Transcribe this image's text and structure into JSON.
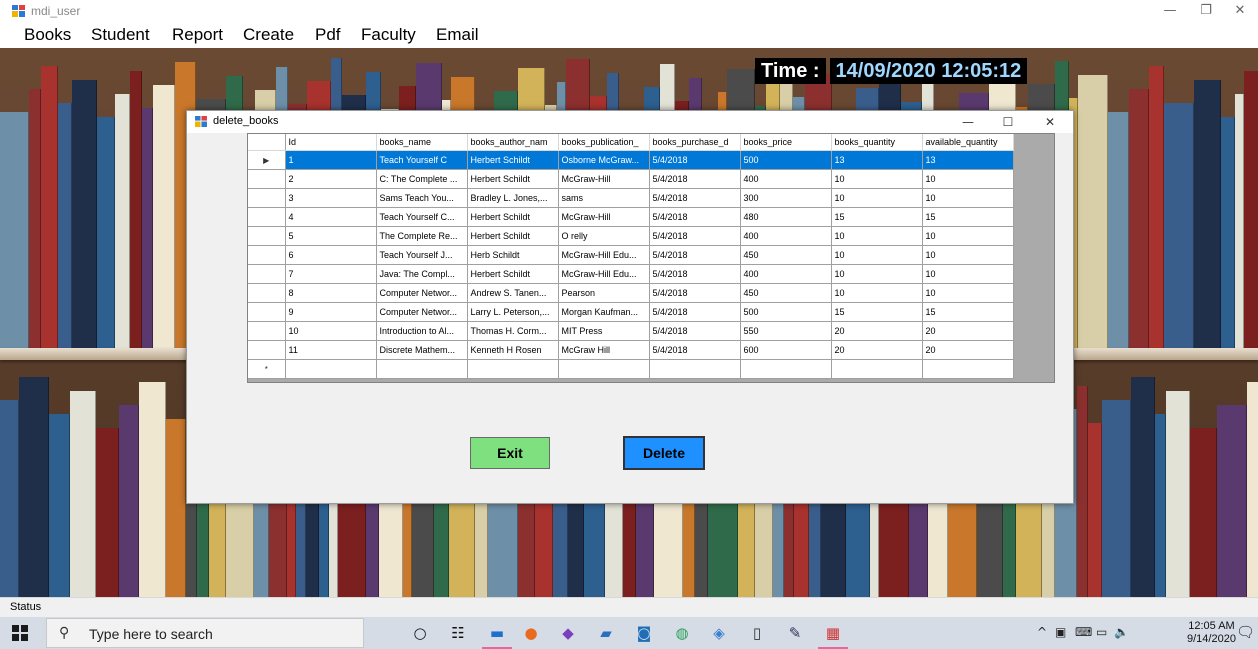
{
  "window": {
    "title": "mdi_user",
    "minimize_glyph": "—",
    "restore_glyph": "❐",
    "close_glyph": "✕"
  },
  "menu": [
    "Books",
    "Student",
    "Report",
    "Create",
    "Pdf",
    "Faculty",
    "Email"
  ],
  "clock_banner": {
    "label": "Time :",
    "value": "14/09/2020 12:05:12"
  },
  "dialog": {
    "title": "delete_books",
    "minimize_glyph": "—",
    "maximize_glyph": "☐",
    "close_glyph": "✕",
    "columns": [
      "Id",
      "books_name",
      "books_author_nam",
      "books_publication_",
      "books_purchase_d",
      "books_price",
      "books_quantity",
      "available_quantity"
    ],
    "rows": [
      [
        "1",
        "Teach Yourself C",
        "Herbert Schildt",
        "Osborne McGraw...",
        "5/4/2018",
        "500",
        "13",
        "13"
      ],
      [
        "2",
        "C: The Complete ...",
        "Herbert Schildt",
        "McGraw-Hill",
        "5/4/2018",
        "400",
        "10",
        "10"
      ],
      [
        "3",
        "Sams Teach You...",
        "Bradley L. Jones,...",
        "sams",
        "5/4/2018",
        "300",
        "10",
        "10"
      ],
      [
        "4",
        "Teach Yourself C...",
        "Herbert Schildt",
        "McGraw-Hill",
        "5/4/2018",
        "480",
        "15",
        "15"
      ],
      [
        "5",
        "The Complete Re...",
        "Herbert Schildt",
        "O relly",
        "5/4/2018",
        "400",
        "10",
        "10"
      ],
      [
        "6",
        "Teach Yourself J...",
        "Herb Schildt",
        "McGraw-Hill Edu...",
        "5/4/2018",
        "450",
        "10",
        "10"
      ],
      [
        "7",
        "Java: The Compl...",
        "Herbert Schildt",
        "McGraw-Hill Edu...",
        "5/4/2018",
        "400",
        "10",
        "10"
      ],
      [
        "8",
        "Computer Networ...",
        "Andrew S. Tanen...",
        "Pearson",
        "5/4/2018",
        "450",
        "10",
        "10"
      ],
      [
        "9",
        "Computer Networ...",
        "Larry L. Peterson,...",
        "Morgan Kaufman...",
        "5/4/2018",
        "500",
        "15",
        "15"
      ],
      [
        "10",
        "Introduction to Al...",
        "Thomas H. Corm...",
        "MIT Press",
        "5/4/2018",
        "550",
        "20",
        "20"
      ],
      [
        "11",
        "Discrete Mathem...",
        "Kenneth H Rosen",
        "McGraw Hill",
        "5/4/2018",
        "600",
        "20",
        "20"
      ]
    ],
    "selected_row_index": 0,
    "current_row_glyph": "▶",
    "new_row_glyph": "*",
    "exit_label": "Exit",
    "delete_label": "Delete",
    "exit_color": "#7fe07f",
    "delete_color": "#1e90ff"
  },
  "status": {
    "text": "Status"
  },
  "taskbar": {
    "search_placeholder": "Type here to search",
    "icons": [
      "cortana-icon",
      "task-view-icon",
      "file-explorer-icon",
      "firefox-icon",
      "visual-studio-icon",
      "app-icon",
      "outlook-icon",
      "upwork-icon",
      "app-icon-2",
      "notepad-icon",
      "paint-icon",
      "mdi-app-icon"
    ],
    "time": "12:05 AM",
    "date": "9/14/2020",
    "notification_count": "1"
  }
}
